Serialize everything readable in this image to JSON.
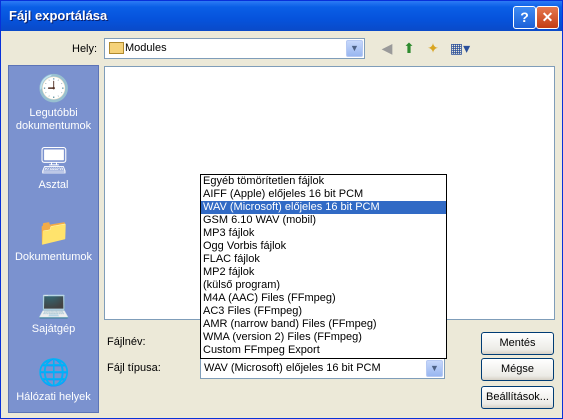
{
  "window": {
    "title": "Fájl exportálása",
    "help_label": "?",
    "close_label": "✕"
  },
  "location": {
    "label": "Hely:",
    "value": "Modules"
  },
  "places": [
    {
      "label": "Legutóbbi dokumentumok",
      "icon": "recent-docs-icon"
    },
    {
      "label": "Asztal",
      "icon": "desktop-icon"
    },
    {
      "label": "Dokumentumok",
      "icon": "documents-folder-icon"
    },
    {
      "label": "Sajátgép",
      "icon": "my-computer-icon"
    },
    {
      "label": "Hálózati helyek",
      "icon": "network-places-icon"
    }
  ],
  "filename": {
    "label": "Fájlnév:",
    "value": ""
  },
  "filetype": {
    "label": "Fájl típusa:",
    "value": "WAV (Microsoft) előjeles 16 bit PCM",
    "options": [
      "Egyéb tömörítetlen fájlok",
      "AIFF (Apple) előjeles 16 bit PCM",
      "WAV (Microsoft) előjeles 16 bit PCM",
      "GSM 6.10 WAV (mobil)",
      "MP3 fájlok",
      "Ogg Vorbis fájlok",
      "FLAC fájlok",
      "MP2 fájlok",
      "(külső program)",
      "M4A (AAC) Files (FFmpeg)",
      "AC3 Files (FFmpeg)",
      "AMR (narrow band) Files (FFmpeg)",
      "WMA (version 2) Files (FFmpeg)",
      "Custom FFmpeg Export"
    ],
    "selected_index": 2
  },
  "buttons": {
    "save": "Mentés",
    "cancel": "Mégse",
    "options": "Beállítások..."
  },
  "colors": {
    "titlebar": "#0a5fe6",
    "places_bg": "#7b92cf",
    "selection": "#316ac5"
  }
}
